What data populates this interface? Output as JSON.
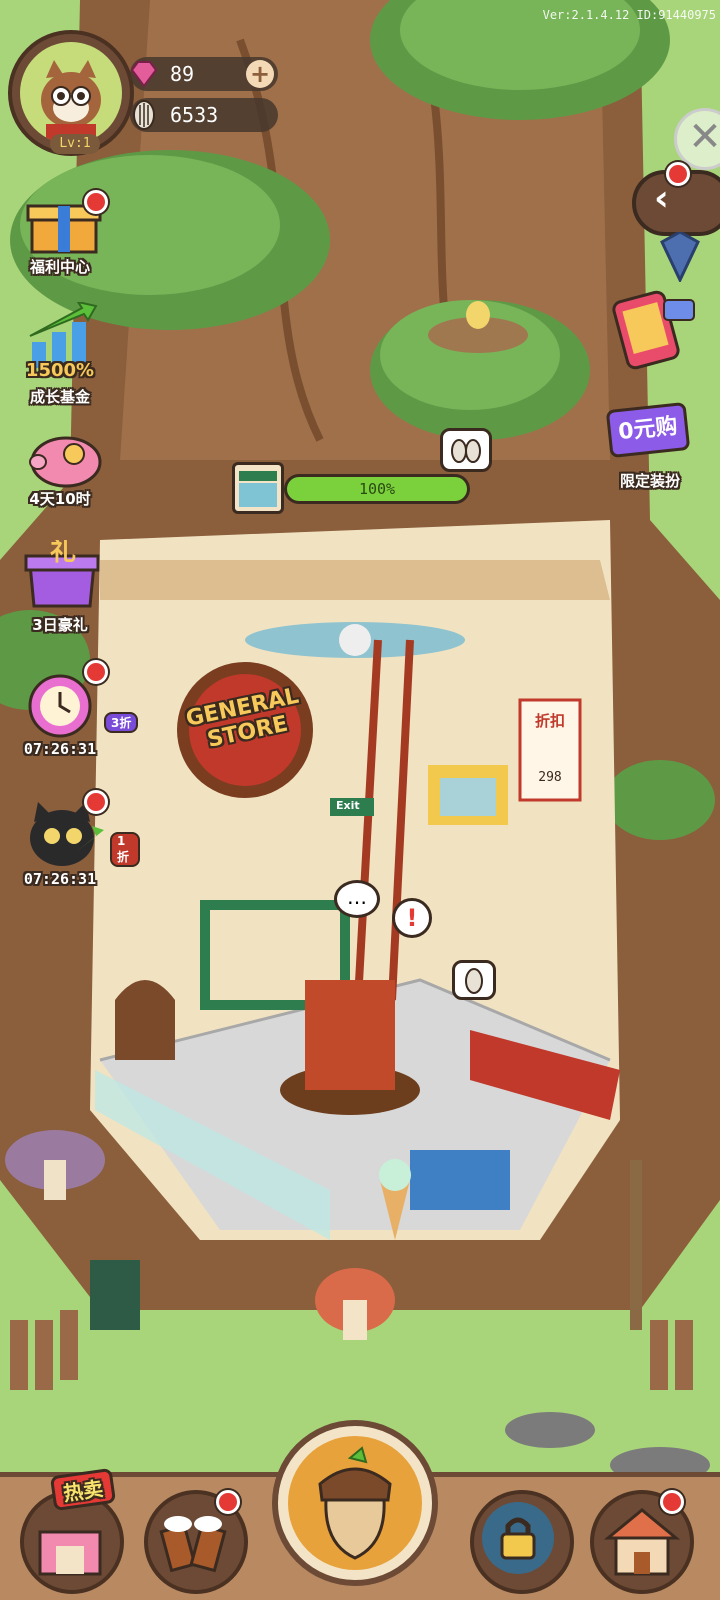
{
  "version_text": "Ver:2.1.4.12 ID:91440975",
  "player": {
    "level_label": "Lv:1",
    "gems": "89",
    "seeds": "6533"
  },
  "left_menu": [
    {
      "label": "福利中心"
    },
    {
      "label": "成长基金",
      "banner": "1500%"
    },
    {
      "label": "4天10时"
    },
    {
      "label": "3日豪礼"
    },
    {
      "label": "07:26:31",
      "tag": "3折"
    },
    {
      "label": "07:26:31",
      "tag": "1折"
    }
  ],
  "right_menu": {
    "limited_outfit_label": "限定装扮",
    "zero_yuan_label": "0元购"
  },
  "store": {
    "progress_text": "100%",
    "progress_value": 100,
    "sign_text_1": "GENERAL",
    "sign_text_2": "STORE",
    "exit_text": "Exit",
    "poster_title": "折扣",
    "poster_price": "298"
  },
  "bottom_bar": {
    "hot_sale_label": "热卖"
  },
  "colors": {
    "grass": "#a8d57a",
    "trunk": "#8b5e3c",
    "leaves": "#5e9a45",
    "progress_fill": "#7ad13c",
    "badge": "#e53935"
  }
}
